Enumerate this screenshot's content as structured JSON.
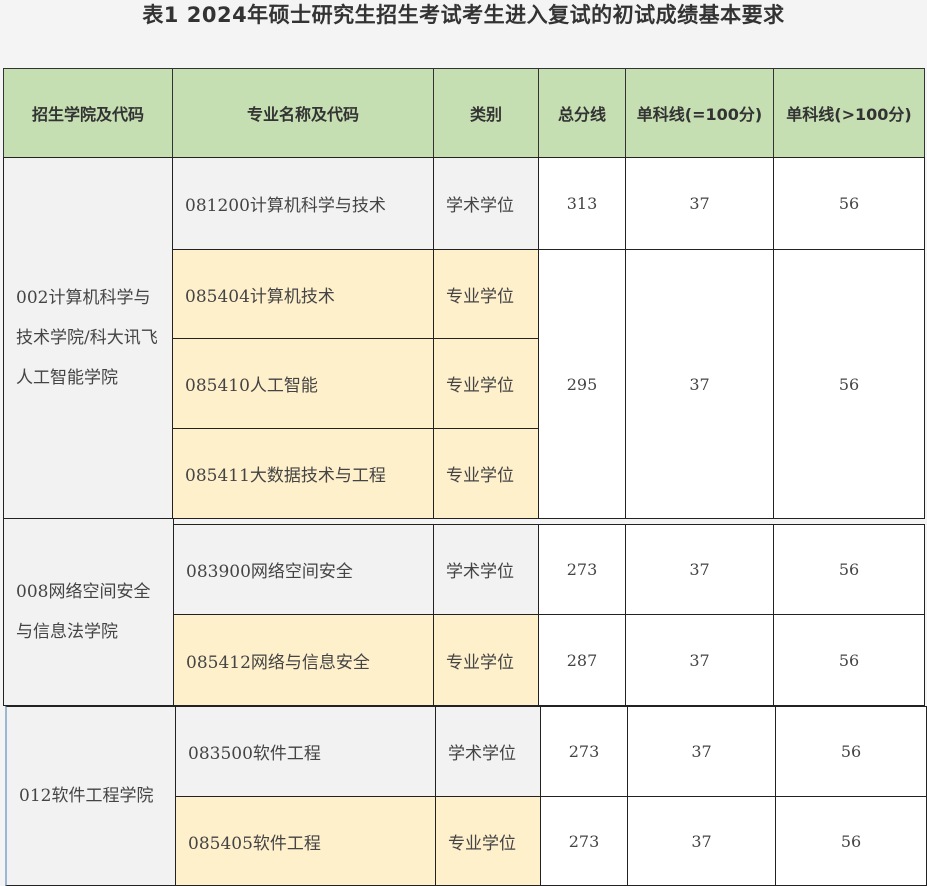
{
  "title": "表1  2024年硕士研究生招生考试考生进入复试的初试成绩基本要求",
  "headers": {
    "college": "招生学院及代码",
    "major": "专业名称及代码",
    "type": "类别",
    "total": "总分线",
    "single100": "单科线(=100分)",
    "single_gt100": "单科线(>100分)"
  },
  "colleges": [
    "002计算机科学与技术学院/科大讯飞人工智能学院",
    "008网络空间安全与信息法学院",
    "012软件工程学院"
  ],
  "rows": [
    {
      "major": "081200计算机科学与技术",
      "type": "学术学位",
      "total": "313",
      "single100": "37",
      "single_gt100": "56"
    },
    {
      "major": "085404计算机技术",
      "type": "专业学位",
      "total": "295",
      "single100": "37",
      "single_gt100": "56"
    },
    {
      "major": "085410人工智能",
      "type": "专业学位"
    },
    {
      "major": "085411大数据技术与工程",
      "type": "专业学位"
    },
    {
      "major": "083900网络空间安全",
      "type": "学术学位",
      "total": "273",
      "single100": "37",
      "single_gt100": "56"
    },
    {
      "major": "085412网络与信息安全",
      "type": "专业学位",
      "total": "287",
      "single100": "37",
      "single_gt100": "56"
    },
    {
      "major": "083500软件工程",
      "type": "学术学位",
      "total": "273",
      "single100": "37",
      "single_gt100": "56"
    },
    {
      "major": "085405软件工程",
      "type": "专业学位",
      "total": "273",
      "single100": "37",
      "single_gt100": "56"
    }
  ]
}
